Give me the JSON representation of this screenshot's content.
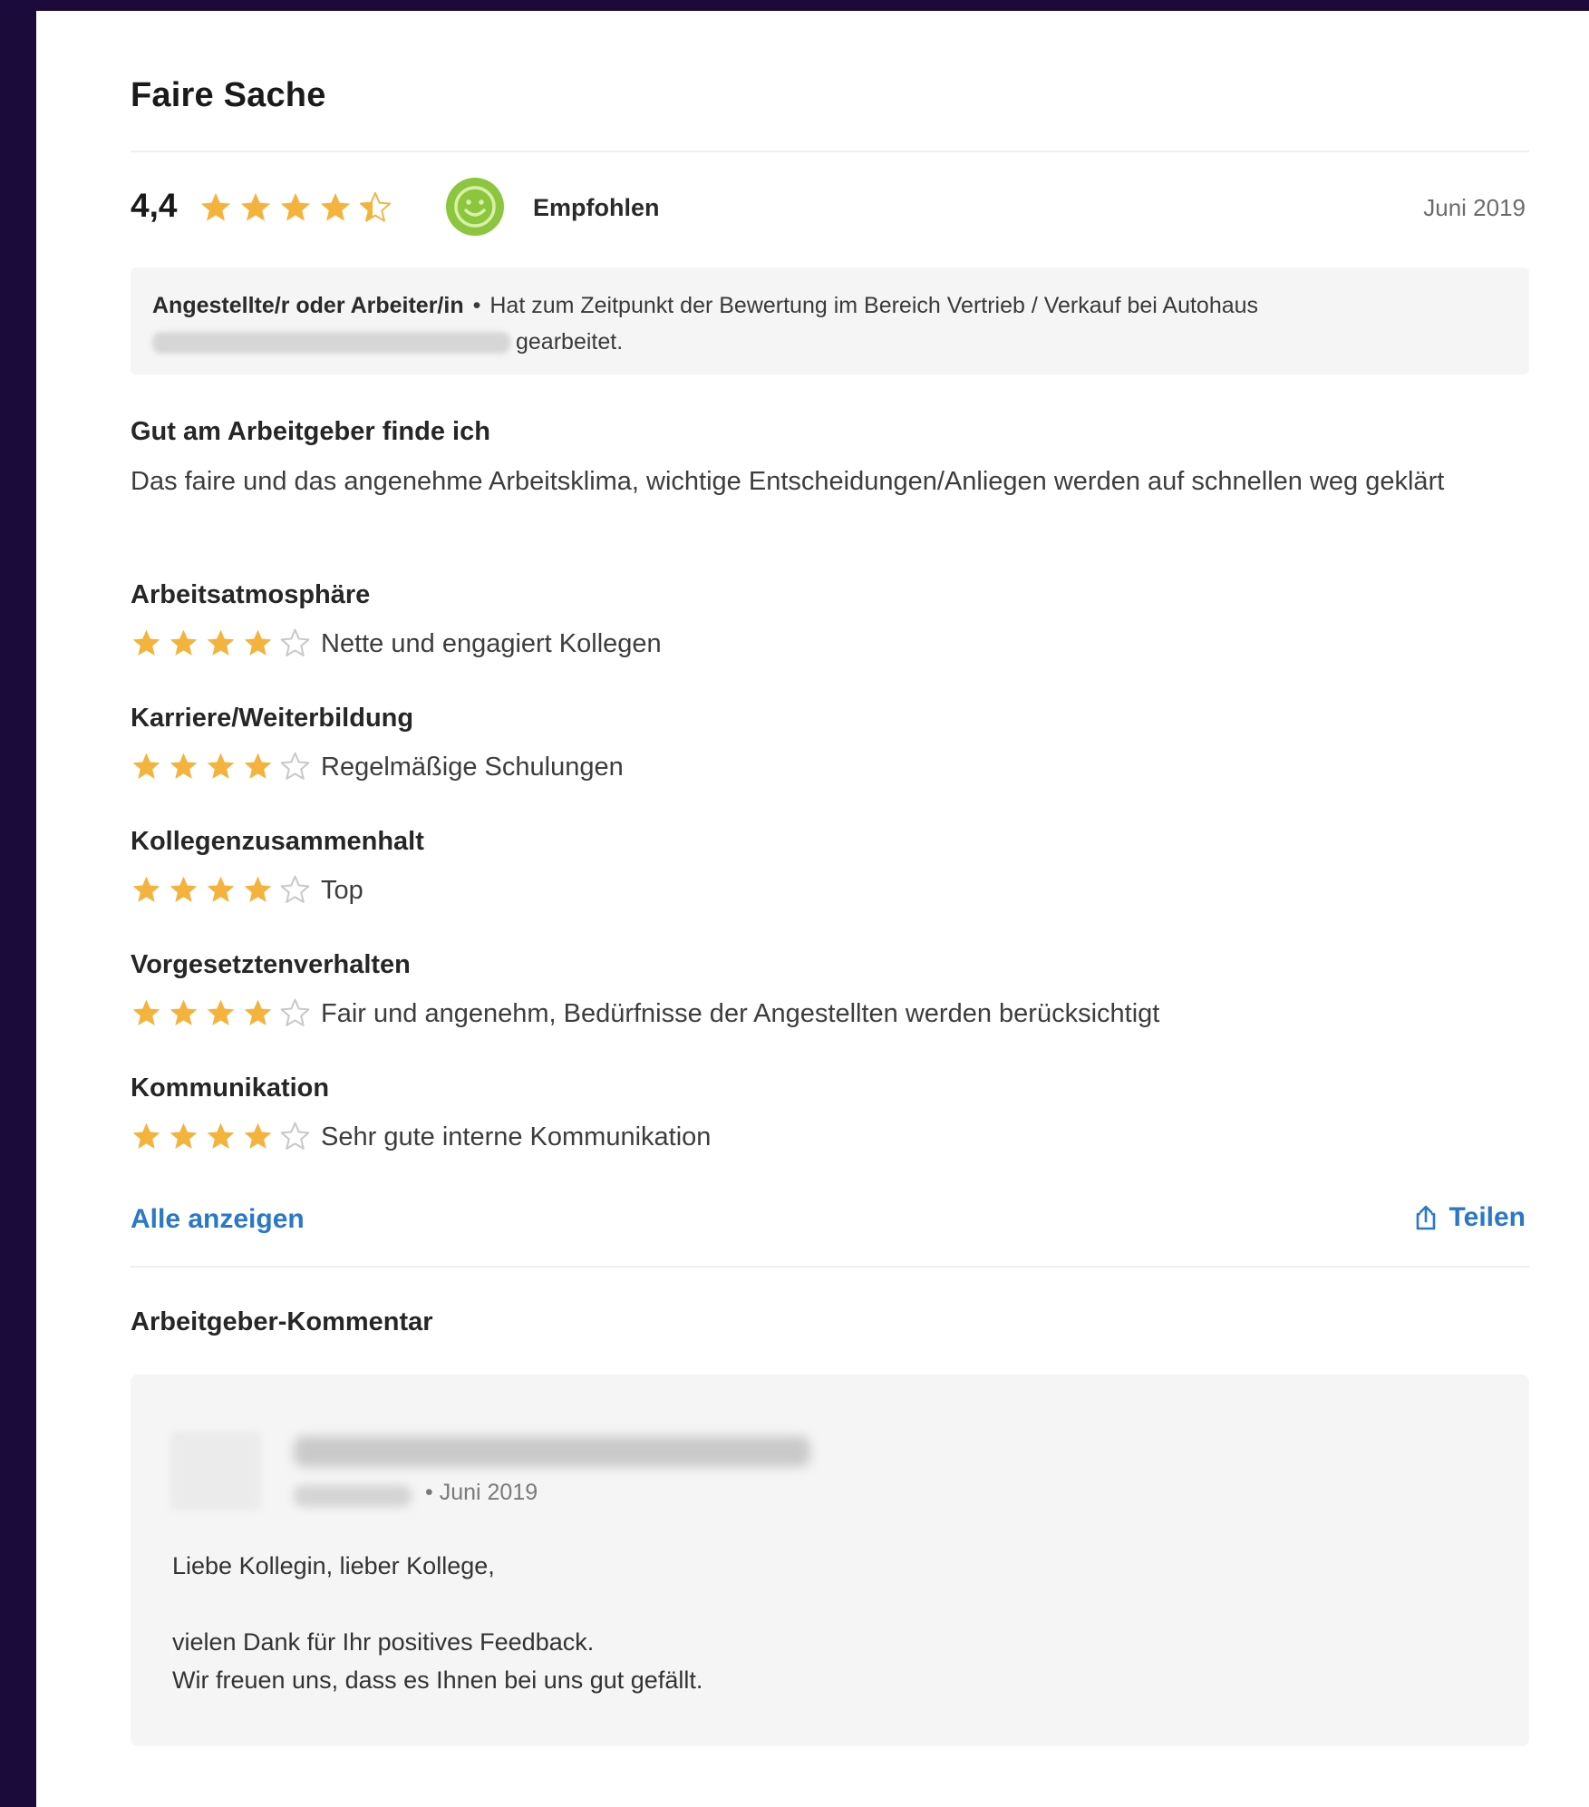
{
  "review": {
    "title": "Faire Sache",
    "overall_score": "4,4",
    "overall_rating": 4.4,
    "recommend_label": "Empfohlen",
    "date": "Juni 2019",
    "job": {
      "role": "Angestellte/r oder Arbeiter/in",
      "separator": "•",
      "description_start": "Hat zum Zeitpunkt der Bewertung im Bereich Vertrieb / Verkauf bei Autohaus",
      "description_end": "gearbeitet."
    },
    "pro": {
      "heading": "Gut am Arbeitgeber finde ich",
      "text": "Das faire und das angenehme Arbeitsklima, wichtige Entscheidungen/Anliegen werden auf schnellen weg geklärt"
    },
    "categories": [
      {
        "title": "Arbeitsatmosphäre",
        "rating": 4,
        "text": "Nette und engagiert Kollegen"
      },
      {
        "title": "Karriere/Weiterbildung",
        "rating": 4,
        "text": "Regelmäßige Schulungen"
      },
      {
        "title": "Kollegenzusammenhalt",
        "rating": 4,
        "text": "Top"
      },
      {
        "title": "Vorgesetztenverhalten",
        "rating": 4,
        "text": "Fair und angenehm, Bedürfnisse der Angestellten werden berücksichtigt"
      },
      {
        "title": "Kommunikation",
        "rating": 4,
        "text": "Sehr gute interne Kommunikation"
      }
    ],
    "show_all_label": "Alle anzeigen",
    "share_label": "Teilen"
  },
  "employer_comment": {
    "heading": "Arbeitgeber-Kommentar",
    "date_prefix": "•",
    "date": "Juni 2019",
    "greeting": "Liebe Kollegin, lieber Kollege,",
    "line1": "vielen Dank für Ihr positives Feedback.",
    "line2": "Wir freuen uns, dass es Ihnen bei uns gut gefällt."
  },
  "colors": {
    "star_filled": "#f3b33d",
    "star_empty": "#c9c9c9",
    "recommend_green": "#8cc63e",
    "link_blue": "#2a78c6",
    "frame": "#1c0a3c"
  },
  "icons": {
    "star": "star-icon",
    "recommend": "smiley-icon",
    "share": "share-icon"
  }
}
